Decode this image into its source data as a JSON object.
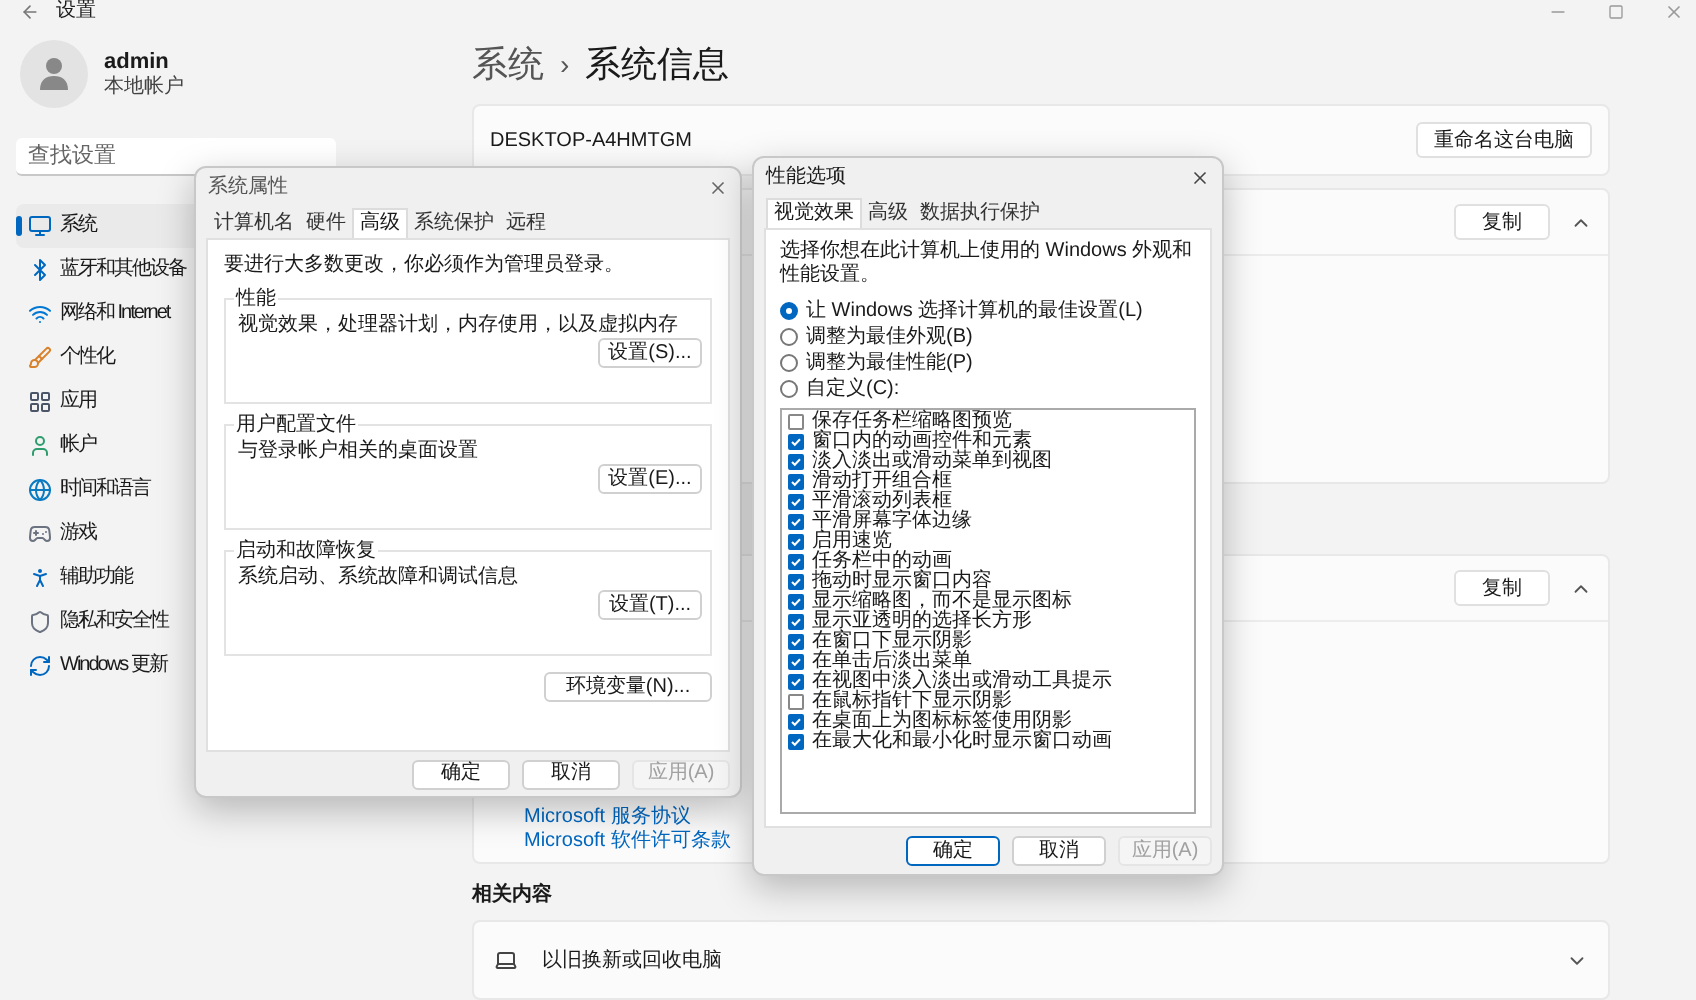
{
  "titlebar": {
    "title": "设置"
  },
  "account": {
    "name": "admin",
    "type": "本地帐户"
  },
  "search": {
    "placeholder": "查找设置"
  },
  "nav": [
    {
      "label": "系统",
      "selected": true
    },
    {
      "label": "蓝牙和其他设备",
      "selected": false
    },
    {
      "label": "网络和 Internet",
      "selected": false
    },
    {
      "label": "个性化",
      "selected": false
    },
    {
      "label": "应用",
      "selected": false
    },
    {
      "label": "帐户",
      "selected": false
    },
    {
      "label": "时间和语言",
      "selected": false
    },
    {
      "label": "游戏",
      "selected": false
    },
    {
      "label": "辅助功能",
      "selected": false
    },
    {
      "label": "隐私和安全性",
      "selected": false
    },
    {
      "label": "Windows 更新",
      "selected": false
    }
  ],
  "breadcrumb": {
    "parent": "系统",
    "separator": "›",
    "current": "系统信息"
  },
  "device_card": {
    "name": "DESKTOP-A4HMTGM",
    "button": "重命名这台电脑"
  },
  "spec_cards": [
    {
      "button": "复制",
      "expanded": true
    },
    {
      "button": "复制",
      "expanded": true,
      "links": [
        "Microsoft 服务协议",
        "Microsoft 软件许可条款"
      ]
    }
  ],
  "related": {
    "title": "相关内容",
    "items": [
      {
        "label": "以旧换新或回收电脑",
        "expanded": false
      }
    ]
  },
  "system_properties": {
    "title": "系统属性",
    "tabs": [
      {
        "label": "计算机名",
        "selected": false
      },
      {
        "label": "硬件",
        "selected": false
      },
      {
        "label": "高级",
        "selected": true
      },
      {
        "label": "系统保护",
        "selected": false
      },
      {
        "label": "远程",
        "selected": false
      }
    ],
    "notice": "要进行大多数更改，你必须作为管理员登录。",
    "groups": [
      {
        "title": "性能",
        "description": "视觉效果，处理器计划，内存使用，以及虚拟内存",
        "button": "设置(S)..."
      },
      {
        "title": "用户配置文件",
        "description": "与登录帐户相关的桌面设置",
        "button": "设置(E)..."
      },
      {
        "title": "启动和故障恢复",
        "description": "系统启动、系统故障和调试信息",
        "button": "设置(T)..."
      }
    ],
    "env_button": "环境变量(N)...",
    "buttons": [
      {
        "label": "确定",
        "disabled": false,
        "default": false
      },
      {
        "label": "取消",
        "disabled": false,
        "default": false
      },
      {
        "label": "应用(A)",
        "disabled": true,
        "default": false
      }
    ]
  },
  "performance_options": {
    "title": "性能选项",
    "tabs": [
      {
        "label": "视觉效果",
        "selected": true
      },
      {
        "label": "高级",
        "selected": false
      },
      {
        "label": "数据执行保护",
        "selected": false
      }
    ],
    "description": "选择你想在此计算机上使用的 Windows 外观和性能设置。",
    "radios": [
      {
        "label": "让 Windows 选择计算机的最佳设置(L)",
        "selected": true
      },
      {
        "label": "调整为最佳外观(B)",
        "selected": false
      },
      {
        "label": "调整为最佳性能(P)",
        "selected": false
      },
      {
        "label": "自定义(C):",
        "selected": false
      }
    ],
    "effects": [
      {
        "label": "保存任务栏缩略图预览",
        "checked": false
      },
      {
        "label": "窗口内的动画控件和元素",
        "checked": true
      },
      {
        "label": "淡入淡出或滑动菜单到视图",
        "checked": true
      },
      {
        "label": "滑动打开组合框",
        "checked": true
      },
      {
        "label": "平滑滚动列表框",
        "checked": true
      },
      {
        "label": "平滑屏幕字体边缘",
        "checked": true
      },
      {
        "label": "启用速览",
        "checked": true
      },
      {
        "label": "任务栏中的动画",
        "checked": true
      },
      {
        "label": "拖动时显示窗口内容",
        "checked": true
      },
      {
        "label": "显示缩略图，而不是显示图标",
        "checked": true
      },
      {
        "label": "显示亚透明的选择长方形",
        "checked": true
      },
      {
        "label": "在窗口下显示阴影",
        "checked": true
      },
      {
        "label": "在单击后淡出菜单",
        "checked": true
      },
      {
        "label": "在视图中淡入淡出或滑动工具提示",
        "checked": true
      },
      {
        "label": "在鼠标指针下显示阴影",
        "checked": false
      },
      {
        "label": "在桌面上为图标标签使用阴影",
        "checked": true
      },
      {
        "label": "在最大化和最小化时显示窗口动画",
        "checked": true
      }
    ],
    "buttons": [
      {
        "label": "确定",
        "disabled": false,
        "default": true
      },
      {
        "label": "取消",
        "disabled": false,
        "default": false
      },
      {
        "label": "应用(A)",
        "disabled": true,
        "default": false
      }
    ]
  }
}
